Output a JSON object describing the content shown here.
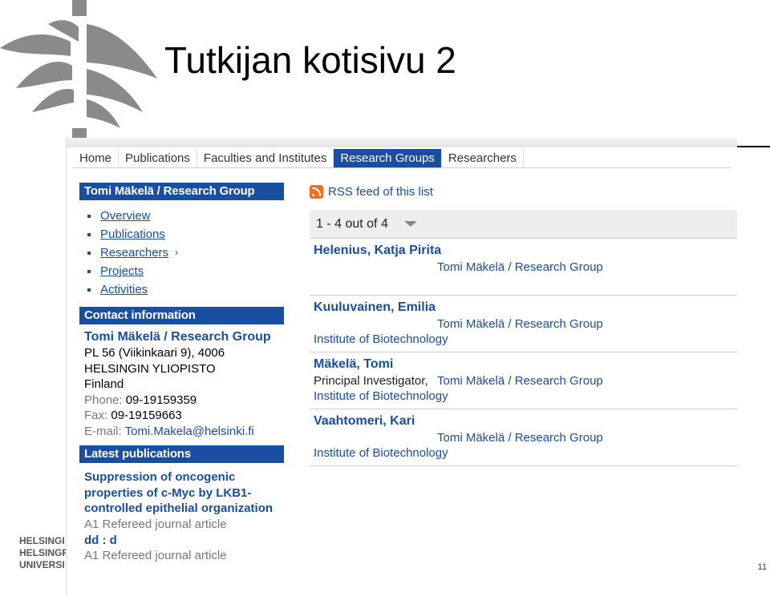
{
  "slide": {
    "title": "Tutkijan kotisivu 2",
    "page_number": "11",
    "university_lines": [
      "HELSINGI",
      "HELSINGF",
      "UNIVERSI"
    ]
  },
  "nav": {
    "items": [
      "Home",
      "Publications",
      "Faculties and Institutes",
      "Research Groups",
      "Researchers"
    ],
    "active_index": 3
  },
  "sidebar": {
    "group_heading": "Tomi Mäkelä / Research Group",
    "menu": [
      "Overview",
      "Publications",
      "Researchers",
      "Projects",
      "Activities"
    ],
    "contact_heading": "Contact information",
    "contact": {
      "name": "Tomi Mäkelä / Research Group",
      "address1": "PL 56 (Viikinkaari 9), 4006",
      "address2": "HELSINGIN YLIOPISTO",
      "country": "Finland",
      "phone_label": "Phone:",
      "phone": "09-19159359",
      "fax_label": "Fax:",
      "fax": "09-19159663",
      "email_label": "E-mail:",
      "email": "Tomi.Makela@helsinki.fi"
    },
    "latest_heading": "Latest publications",
    "publications": [
      {
        "title": "Suppression of oncogenic properties of c-Myc by LKB1-controlled epithelial organization",
        "type": "A1 Refereed journal article"
      },
      {
        "title": "dd : d",
        "type": "A1 Refereed journal article"
      }
    ]
  },
  "main": {
    "rss_label": "RSS feed of this list",
    "pager": "1 - 4 out of 4",
    "researchers": [
      {
        "name": "Helenius, Katja Pirita",
        "role": "",
        "group": "Tomi Mäkelä / Research Group",
        "institute": ""
      },
      {
        "name": "Kuuluvainen, Emilia",
        "role": "",
        "group": "Tomi Mäkelä / Research Group",
        "institute": "Institute of Biotechnology"
      },
      {
        "name": "Mäkelä, Tomi",
        "role": "Principal Investigator,",
        "group": "Tomi Mäkelä / Research Group",
        "institute": "Institute of Biotechnology"
      },
      {
        "name": "Vaahtomeri, Kari",
        "role": "",
        "group": "Tomi Mäkelä / Research Group",
        "institute": "Institute of Biotechnology"
      }
    ]
  },
  "colors": {
    "accent": "#1a4ea0",
    "rss": "#f26f21",
    "logo": "#8a8a8a"
  }
}
